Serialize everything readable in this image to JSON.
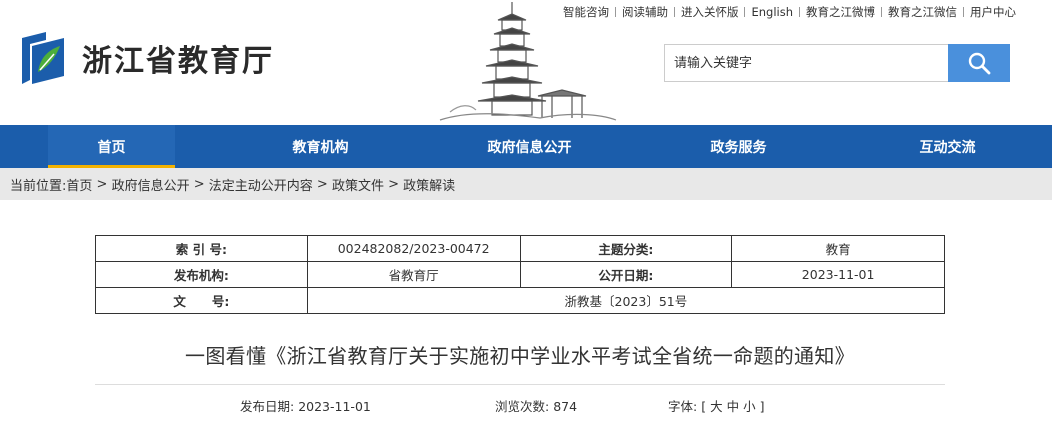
{
  "site": {
    "name": "浙江省教育厅"
  },
  "toplinks": [
    "智能咨询",
    "阅读辅助",
    "进入关怀版",
    "English",
    "教育之江微博",
    "教育之江微信",
    "用户中心"
  ],
  "search": {
    "placeholder": "请输入关键字"
  },
  "nav": [
    {
      "label": "首页",
      "active": true
    },
    {
      "label": "教育机构",
      "active": false
    },
    {
      "label": "政府信息公开",
      "active": false
    },
    {
      "label": "政务服务",
      "active": false
    },
    {
      "label": "互动交流",
      "active": false
    }
  ],
  "breadcrumb": {
    "prefix": "当前位置:",
    "items": [
      "首页",
      "政府信息公开",
      "法定主动公开内容",
      "政策文件",
      "政策解读"
    ],
    "separator": " > "
  },
  "info_table": {
    "index_label": "索 引 号:",
    "index_value": "002482082/2023-00472",
    "topic_label": "主题分类:",
    "topic_value": "教育",
    "org_label": "发布机构:",
    "org_value": "省教育厅",
    "date_label": "公开日期:",
    "date_value": "2023-11-01",
    "docno_label": "文      号:",
    "docno_value": "浙教基〔2023〕51号"
  },
  "article": {
    "title": "一图看懂《浙江省教育厅关于实施初中学业水平考试全省统一命题的通知》",
    "publish_label": "发布日期:",
    "publish_date": "2023-11-01",
    "views_label": "浏览次数:",
    "views": "874",
    "font_label": "字体:",
    "font_open": "[",
    "font_large": "大",
    "font_medium": "中",
    "font_small": "小",
    "font_close": "]"
  },
  "colors": {
    "nav_bg": "#1b5dab",
    "active_underline": "#f3b200",
    "search_button": "#4a90dc",
    "logo_blue": "#1b5dab",
    "logo_green": "#4cae3c"
  }
}
